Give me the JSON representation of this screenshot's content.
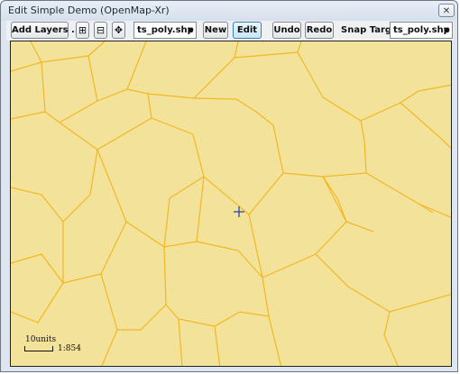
{
  "window": {
    "title": "Edit Simple Demo (OpenMap-Xr)",
    "close_glyph": "✕"
  },
  "toolbar": {
    "add_layers_label": "Add Layers ...",
    "zoom_in_icon": "⊞",
    "zoom_out_icon": "⊟",
    "pan_icon": "✥",
    "layer_select_value": "ts_poly.shp",
    "new_label": "New",
    "edit_label": "Edit",
    "undo_label": "Undo",
    "redo_label": "Redo",
    "snap_target_label": "Snap Target",
    "snap_select_value": "ts_poly.shp",
    "dropdown_arrow": "▼"
  },
  "map": {
    "fill_color": "#f3e39a",
    "edge_color": "#f2b724",
    "cursor_color": "#1f3fa8",
    "scale": {
      "units_label": "10units",
      "ratio_label": "1:854"
    }
  }
}
